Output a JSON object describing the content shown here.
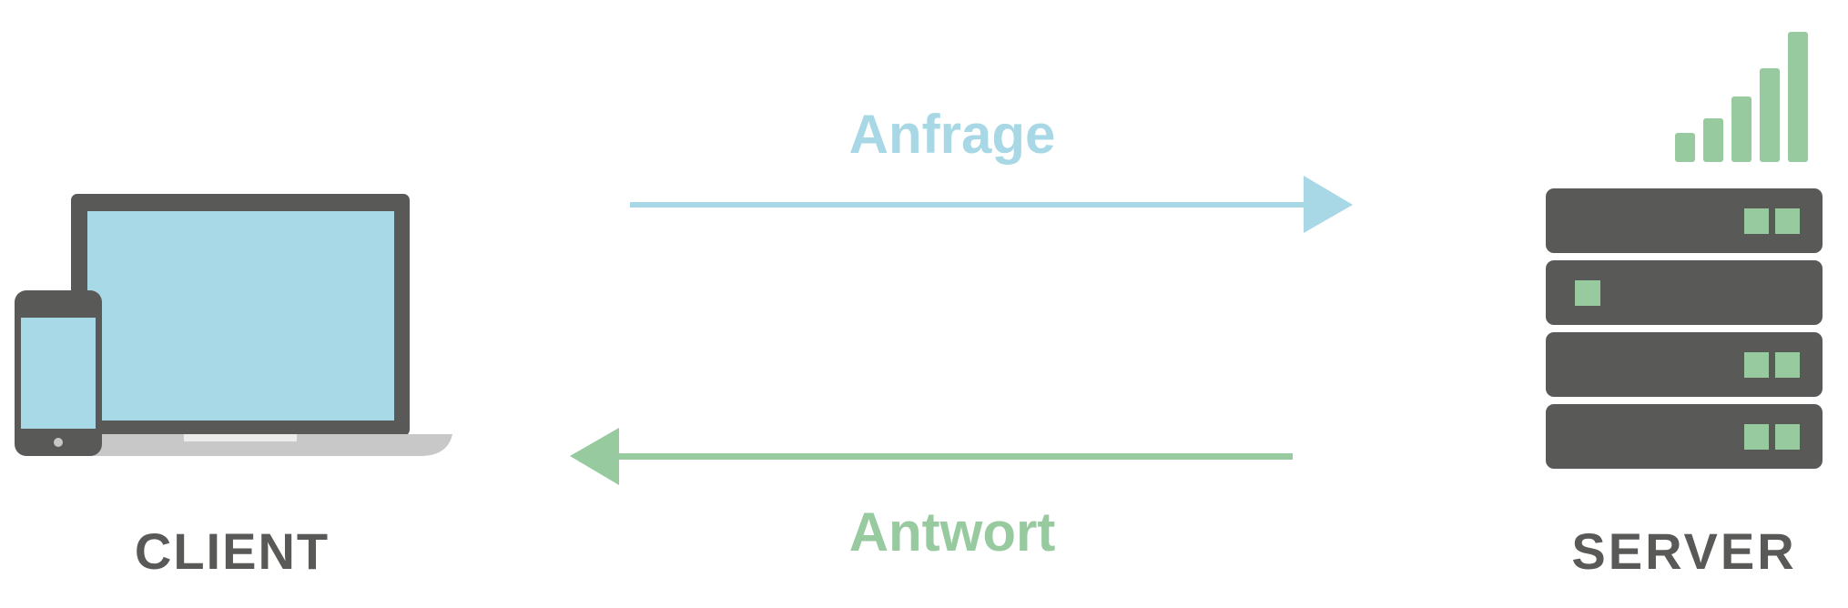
{
  "client": {
    "label": "CLIENT"
  },
  "server": {
    "label": "SERVER"
  },
  "request": {
    "label": "Anfrage"
  },
  "response": {
    "label": "Antwort"
  },
  "colors": {
    "request": "#a8d8e6",
    "response": "#97ca9f",
    "device_dark": "#595957",
    "laptop_base": "#c8c8c8",
    "screen": "#a8d9e6",
    "label_text": "#595957"
  },
  "icons": {
    "client_laptop": "laptop-icon",
    "client_phone": "smartphone-icon",
    "server_rack": "server-rack-icon",
    "signal": "signal-strength-icon"
  },
  "signal_bars": 5,
  "server_units": [
    {
      "indicators": 2,
      "side": "right"
    },
    {
      "indicators": 1,
      "side": "left"
    },
    {
      "indicators": 2,
      "side": "right"
    },
    {
      "indicators": 2,
      "side": "right"
    }
  ]
}
